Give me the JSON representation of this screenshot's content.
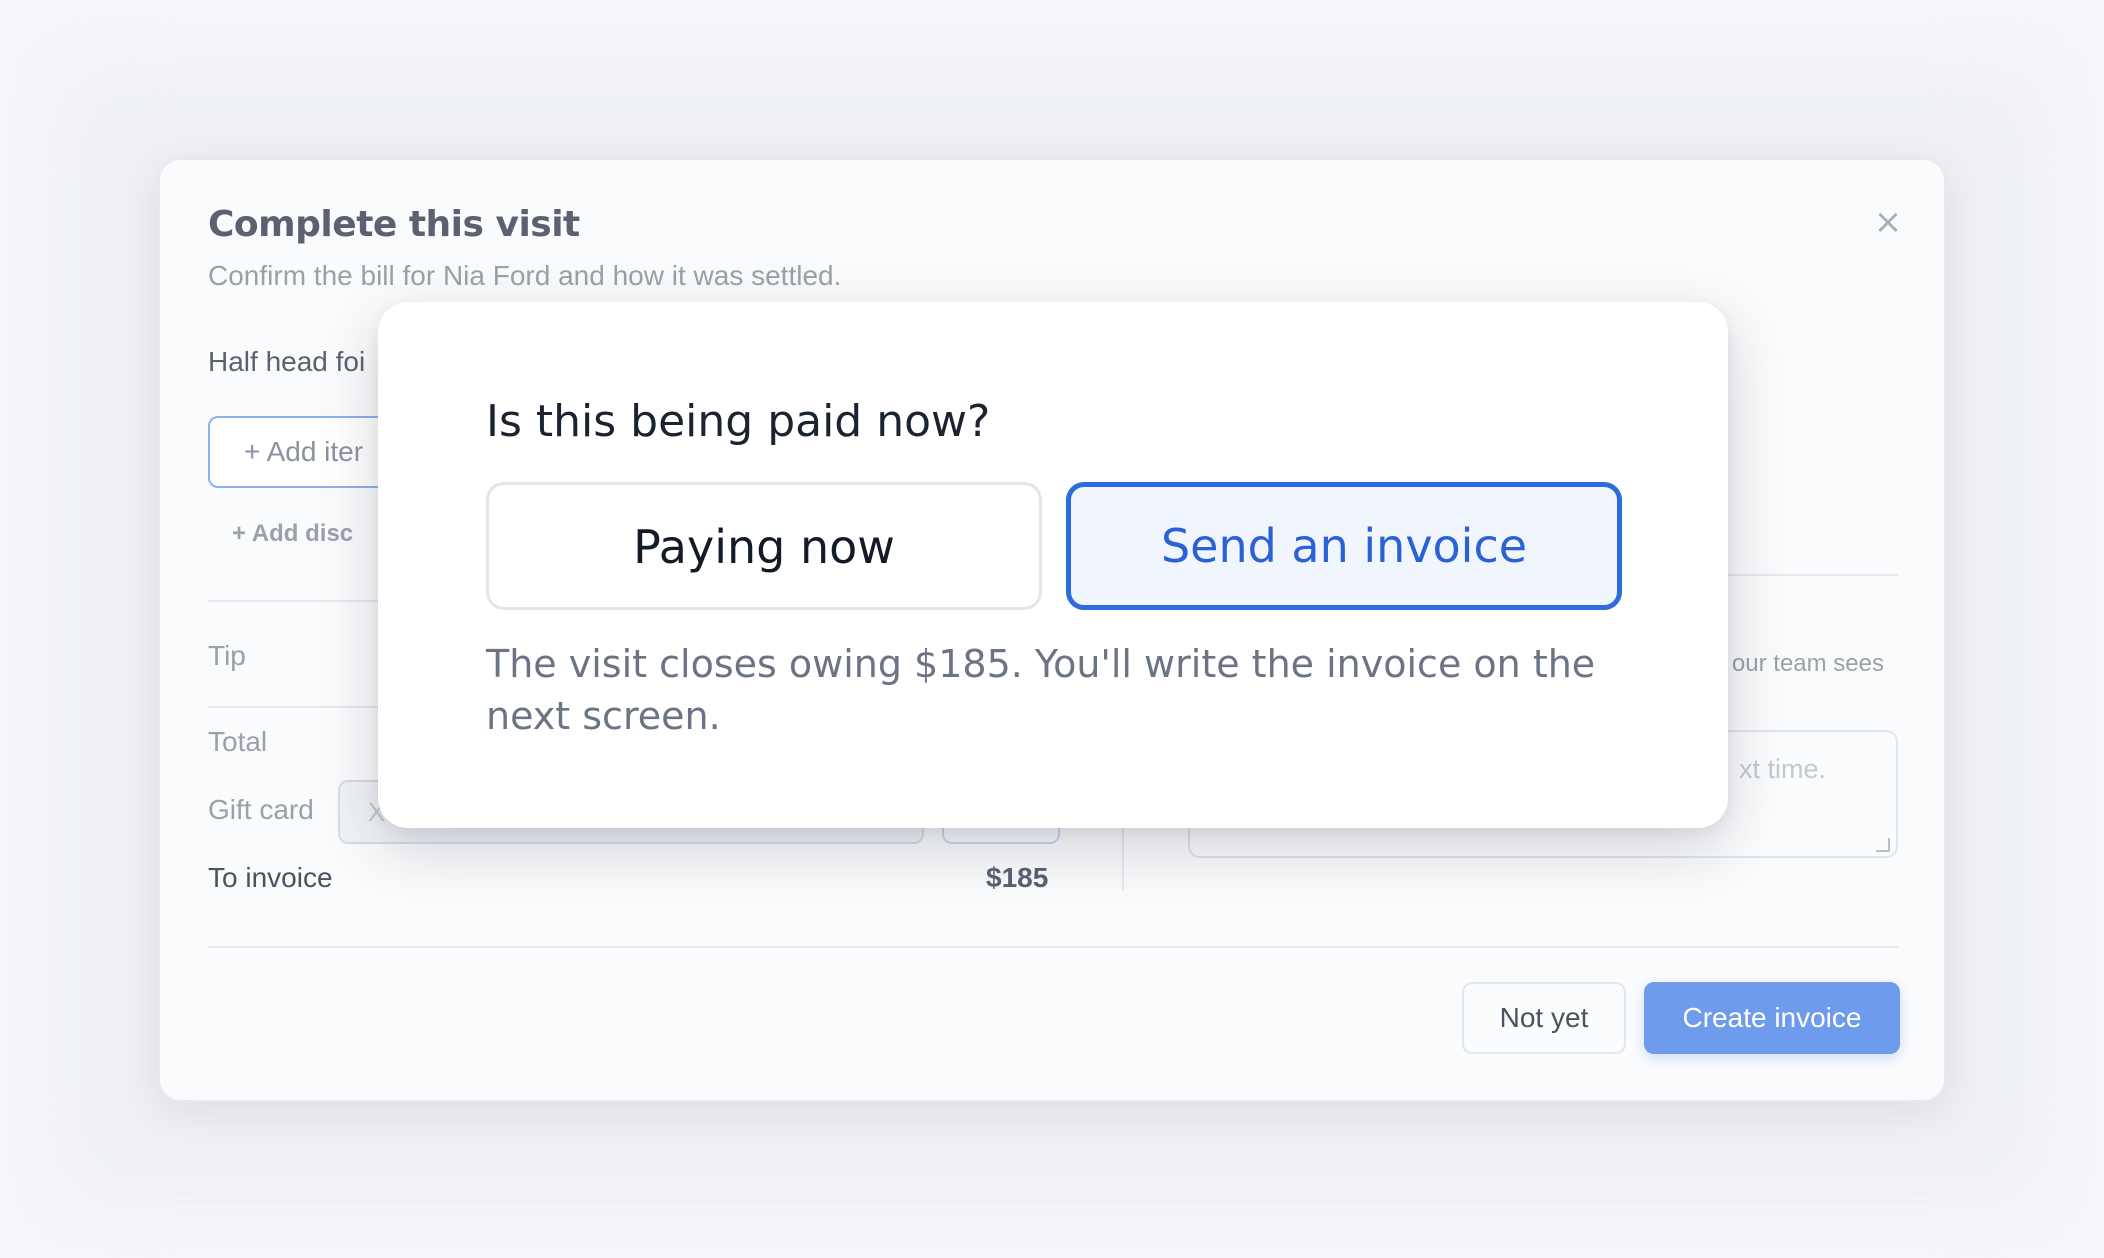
{
  "dialog": {
    "title": "Complete this visit",
    "subtitle": "Confirm the bill for Nia Ford and how it was settled.",
    "close_icon": "×",
    "line_item": "Half head foi",
    "add_item_label": "+  Add iter",
    "add_discount_label": "+   Add disc",
    "tip_label": "Tip",
    "total_label": "Total",
    "gift_card_label": "Gift card",
    "gift_card_placeholder": "X",
    "to_invoice_label": "To invoice",
    "to_invoice_value": "$185",
    "note_hint": "our team sees",
    "note_placeholder": "xt time.",
    "not_yet_label": "Not yet",
    "create_invoice_label": "Create invoice"
  },
  "popover": {
    "question": "Is this being paid now?",
    "option_now": "Paying now",
    "option_invoice": "Send an invoice",
    "selected": "Send an invoice",
    "note": "The visit closes owing $185. You'll write the invoice on the next screen."
  },
  "colors": {
    "accent": "#2f6bdc",
    "primary_button": "#6f9bec"
  }
}
